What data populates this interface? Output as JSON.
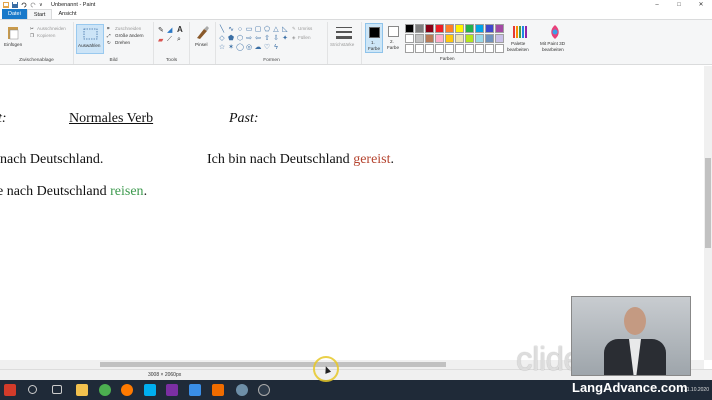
{
  "window": {
    "title": "Unbenannt - Paint",
    "controls": [
      "–",
      "□",
      "✕"
    ]
  },
  "tabs": [
    {
      "label": "Datei"
    },
    {
      "label": "Start"
    },
    {
      "label": "Ansicht"
    }
  ],
  "ribbon": {
    "clipboard": {
      "paste": "Einfügen",
      "cut": "Ausschneiden",
      "copy": "Kopieren",
      "group_label": "Zwischenablage"
    },
    "image": {
      "select": "Auswählen",
      "crop": "Zuschneiden",
      "resize": "Größe ändern",
      "rotate": "Drehen",
      "group_label": "Bild"
    },
    "tools": {
      "group_label": "Tools",
      "brushes": "Pinsel"
    },
    "shapes": {
      "outline": "Umriss",
      "fill": "Füllen",
      "group_label": "Formen"
    },
    "size": {
      "label": "Strichstärke"
    },
    "colors": {
      "color1_line1": "1.",
      "color1_line2": "Farbe",
      "color2_line1": "2.",
      "color2_line2": "Farbe",
      "edit_line1": "Palette",
      "edit_line2": "bearbeiten",
      "paint3d_line1": "Mit Paint 3D",
      "paint3d_line2": "bearbeiten",
      "group_label": "Farben",
      "palette": [
        "#000000",
        "#7f7f7f",
        "#880015",
        "#ed1c24",
        "#ff7f27",
        "#fff200",
        "#22b14c",
        "#00a2e8",
        "#3f48cc",
        "#a349a4",
        "#ffffff",
        "#c3c3c3",
        "#b97a57",
        "#ffaec9",
        "#ffc90e",
        "#efe4b0",
        "#b5e61d",
        "#99d9ea",
        "#7092be",
        "#c8bfe7",
        "#ffffff",
        "#ffffff",
        "#ffffff",
        "#ffffff",
        "#ffffff",
        "#ffffff",
        "#ffffff",
        "#ffffff",
        "#ffffff",
        "#ffffff"
      ]
    }
  },
  "canvas": {
    "row1_col1_partial": "t:",
    "row1_heading": "Normales Verb",
    "row1_past": "Past:",
    "row2_left": "nach Deutschland.",
    "row2_right_prefix": "Ich bin nach Deutschland",
    "row2_right_verb": "gereist",
    "row2_right_suffix": ".",
    "row3_left_prefix": "e nach Deutschland",
    "row3_left_verb": "reisen",
    "row3_left_suffix": "."
  },
  "statusbar": {
    "dimensions": "3008 × 2060px",
    "zoom": "100 %"
  },
  "taskbar": {
    "date": "31.10.2020"
  },
  "watermarks": {
    "clideo": "clideo.com",
    "site": "LangAdvance.com"
  }
}
